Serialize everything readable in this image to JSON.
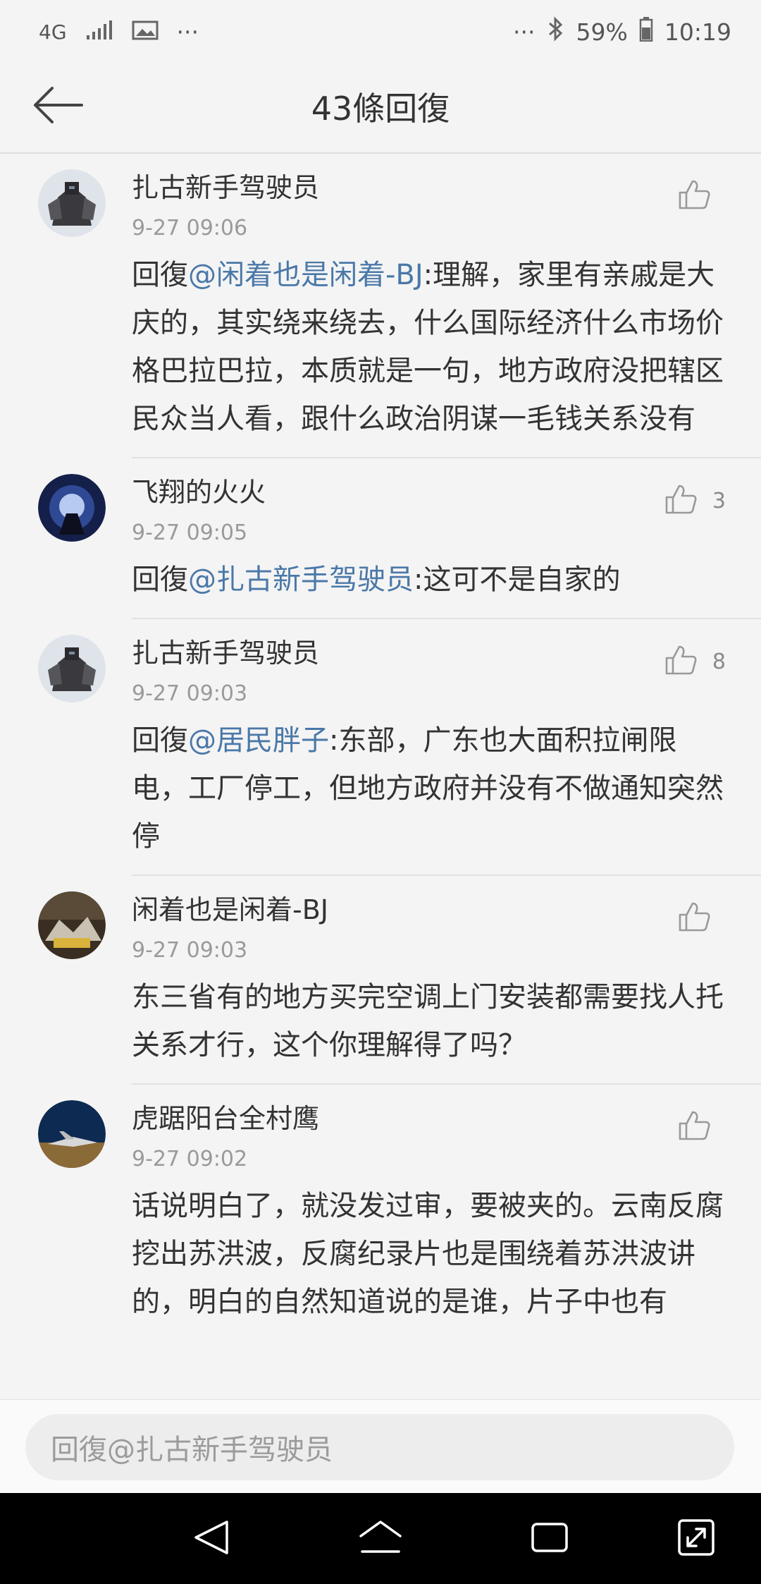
{
  "status_bar": {
    "network": "4G",
    "ellipsis_left": "···",
    "ellipsis_right": "···",
    "battery": "59%",
    "time": "10:19"
  },
  "header": {
    "title": "43條回復"
  },
  "comments": [
    {
      "username": "扎古新手驾驶员",
      "time": "9-27 09:06",
      "prefix": "回復",
      "mention": "@闲着也是闲着-BJ",
      "text": ":理解，家里有亲戚是大庆的，其实绕来绕去，什么国际经济什么市场价格巴拉巴拉，本质就是一句，地方政府没把辖区民众当人看，跟什么政治阴谋一毛钱关系没有",
      "likes": ""
    },
    {
      "username": "飞翔的火火",
      "time": "9-27 09:05",
      "prefix": "回復",
      "mention": "@扎古新手驾驶员",
      "text": ":这可不是自家的",
      "likes": "3"
    },
    {
      "username": "扎古新手驾驶员",
      "time": "9-27 09:03",
      "prefix": "回復",
      "mention": "@居民胖子",
      "text": ":东部，广东也大面积拉闸限电，工厂停工，但地方政府并没有不做通知突然停",
      "likes": "8"
    },
    {
      "username": "闲着也是闲着-BJ",
      "time": "9-27 09:03",
      "prefix": "",
      "mention": "",
      "text": "东三省有的地方买完空调上门安装都需要找人托关系才行，这个你理解得了吗？",
      "likes": ""
    },
    {
      "username": "虎踞阳台全村鹰",
      "time": "9-27 09:02",
      "prefix": "",
      "mention": "",
      "text": "话说明白了，就没发过审，要被夹的。云南反腐挖出苏洪波，反腐纪录片也是围绕着苏洪波讲的，明白的自然知道说的是谁，片子中也有",
      "likes": ""
    }
  ],
  "reply_input": {
    "placeholder": "回復@扎古新手驾驶员"
  },
  "icons": {
    "back": "back-arrow-icon",
    "like": "thumbs-up-icon",
    "nav_back": "nav-back-icon",
    "nav_home": "nav-home-icon",
    "nav_recent": "nav-recent-icon",
    "nav_expand": "nav-expand-icon"
  },
  "colors": {
    "mention": "#4a78a8",
    "background": "#f4f4f4"
  }
}
